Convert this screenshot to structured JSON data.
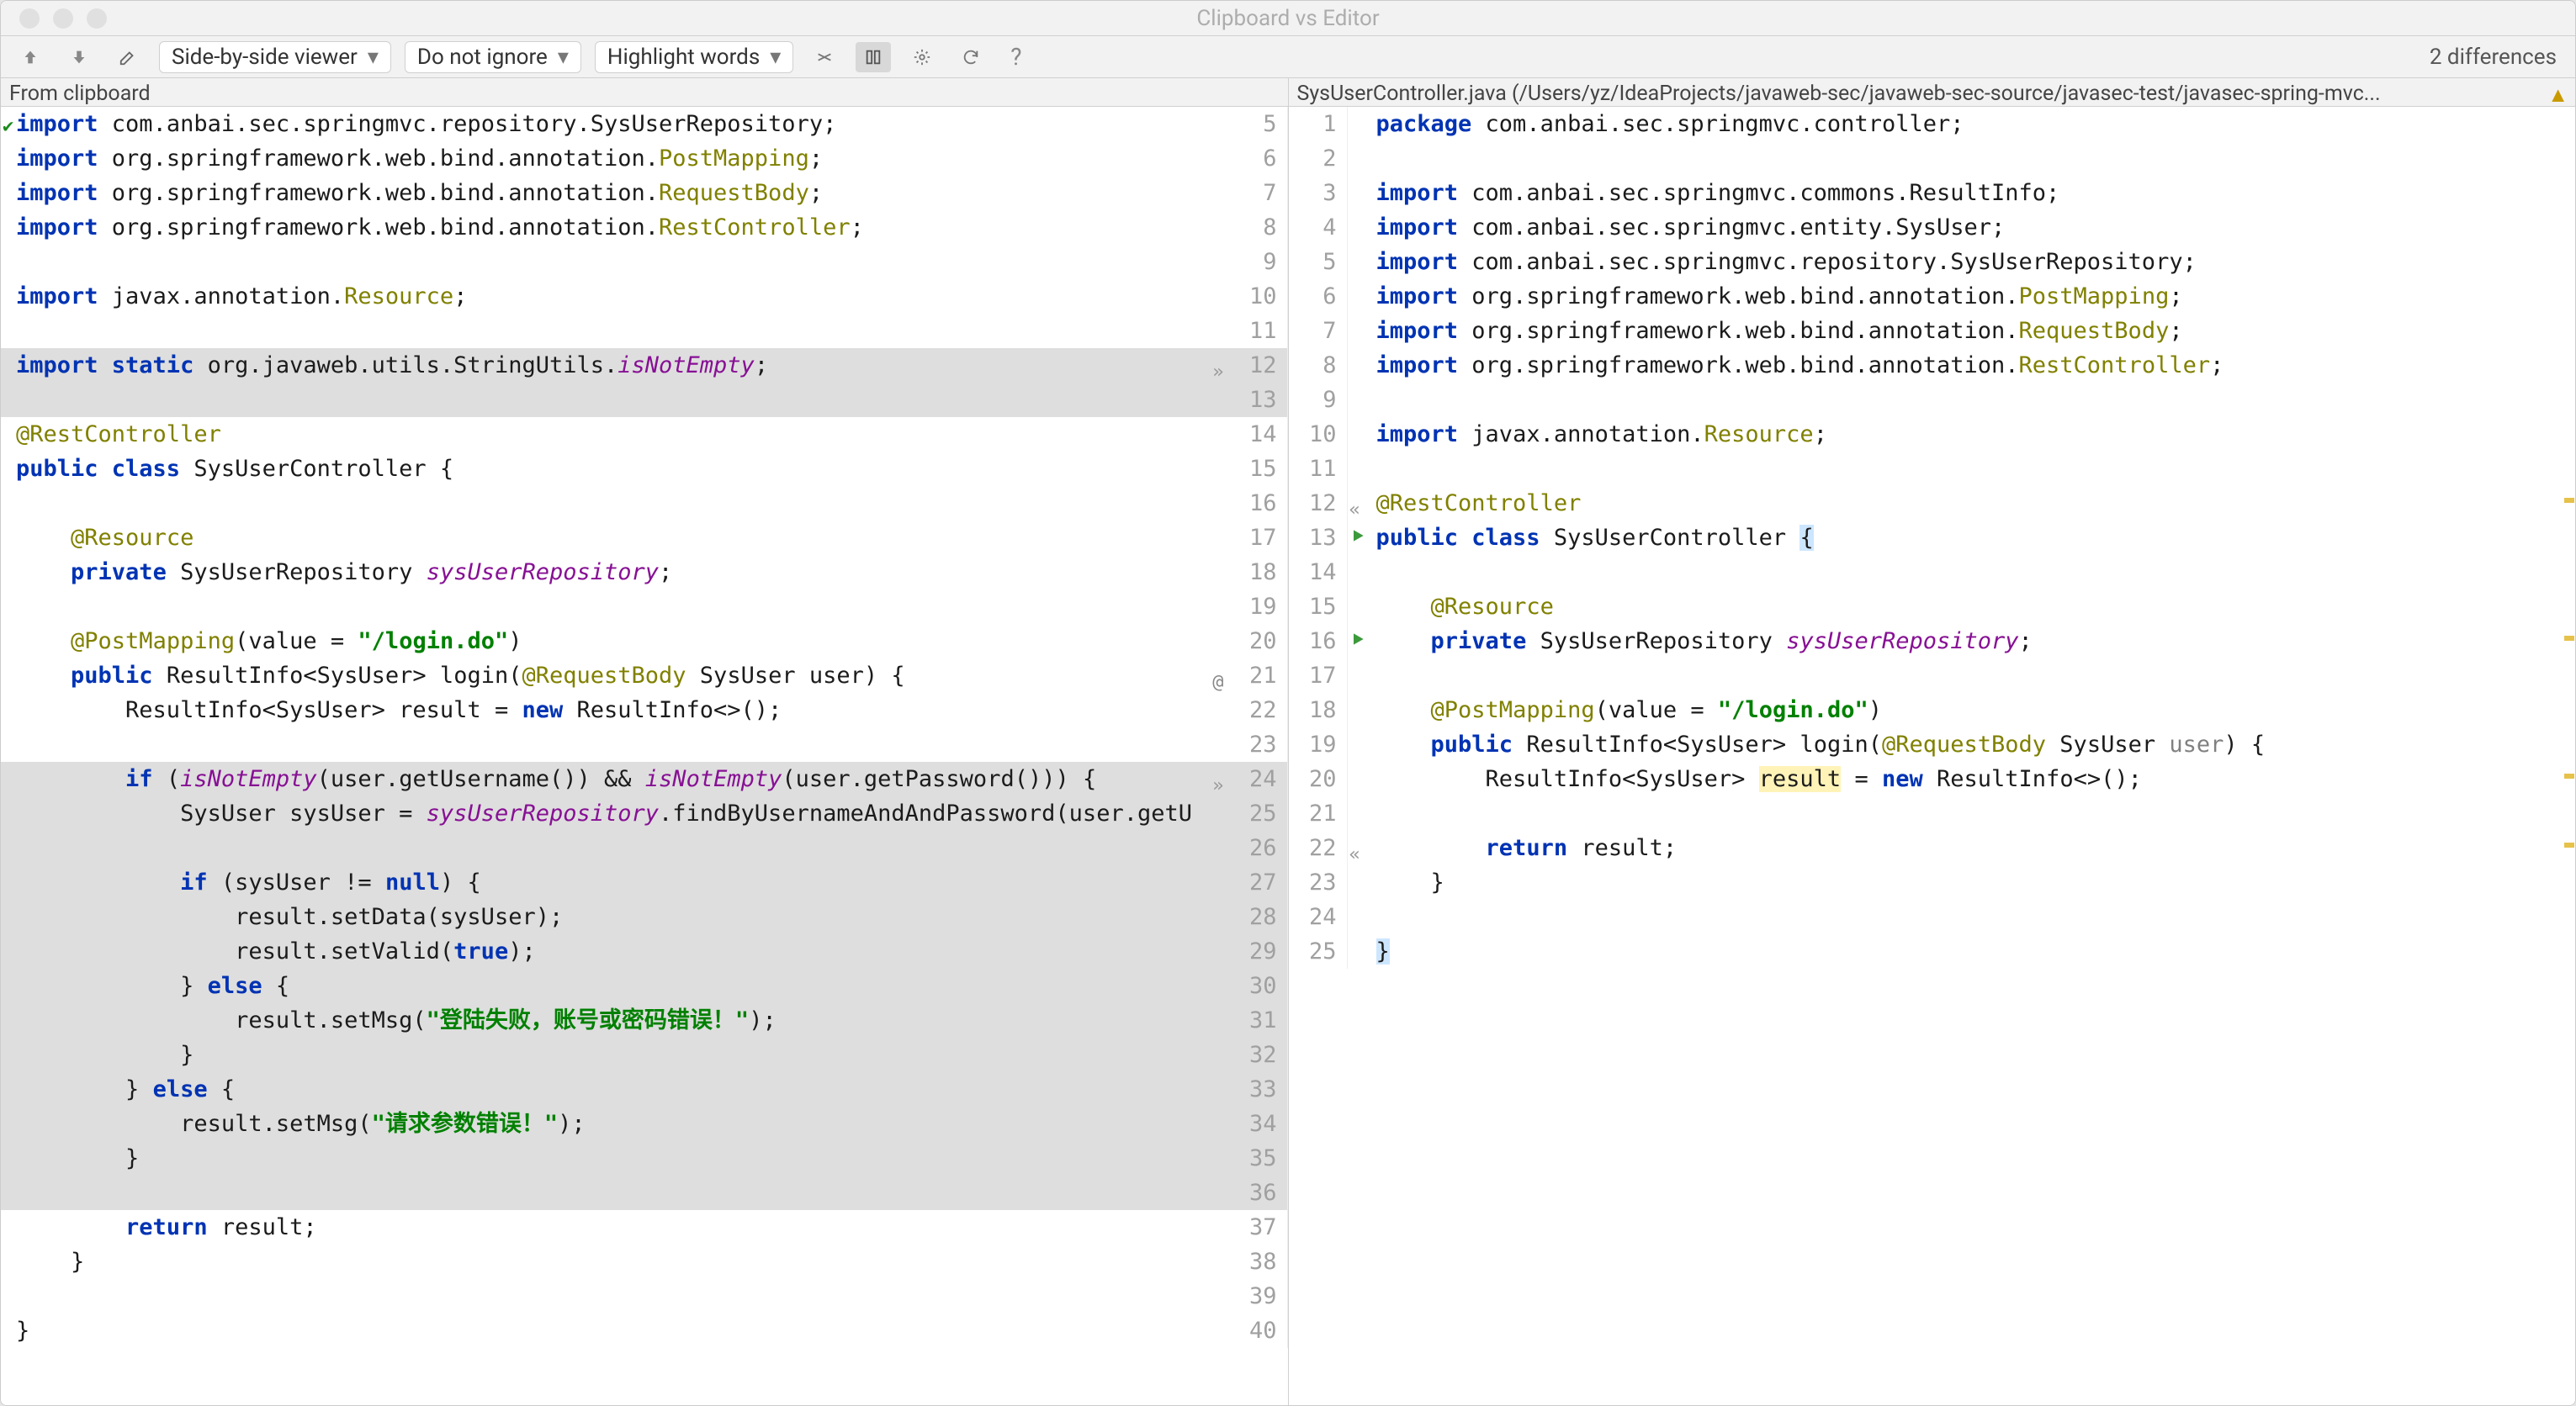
{
  "window": {
    "title": "Clipboard vs Editor"
  },
  "toolbar": {
    "viewer_mode": "Side-by-side viewer",
    "ignore_mode": "Do not ignore",
    "highlight_mode": "Highlight words",
    "diff_count": "2 differences"
  },
  "labels": {
    "left": "From clipboard",
    "right": "SysUserController.java (/Users/yz/IdeaProjects/javaweb-sec/javaweb-sec-source/javasec-test/javasec-spring-mvc..."
  },
  "left_lines": [
    {
      "n": "",
      "tokens": [
        [
          "kw",
          "import "
        ],
        [
          "",
          "com.anbai.sec.springmvc.repository.SysUserRepository;"
        ]
      ],
      "first": true
    },
    {
      "n": "",
      "tokens": [
        [
          "kw",
          "import "
        ],
        [
          "",
          "org.springframework.web.bind.annotation."
        ],
        [
          "ann",
          "PostMapping"
        ],
        [
          "",
          ";"
        ]
      ]
    },
    {
      "n": "",
      "tokens": [
        [
          "kw",
          "import "
        ],
        [
          "",
          "org.springframework.web.bind.annotation."
        ],
        [
          "ann",
          "RequestBody"
        ],
        [
          "",
          ";"
        ]
      ]
    },
    {
      "n": "",
      "tokens": [
        [
          "kw",
          "import "
        ],
        [
          "",
          "org.springframework.web.bind.annotation."
        ],
        [
          "ann",
          "RestController"
        ],
        [
          "",
          ";"
        ]
      ]
    },
    {
      "n": "",
      "tokens": [
        [
          "",
          ""
        ]
      ]
    },
    {
      "n": "",
      "tokens": [
        [
          "kw",
          "import "
        ],
        [
          "",
          "javax.annotation."
        ],
        [
          "ann",
          "Resource"
        ],
        [
          "",
          ";"
        ]
      ]
    },
    {
      "n": "",
      "tokens": [
        [
          "",
          ""
        ]
      ]
    },
    {
      "n": "",
      "tokens": [
        [
          "kw",
          "import static "
        ],
        [
          "",
          "org.javaweb.utils.StringUtils."
        ],
        [
          "idn",
          "isNotEmpty"
        ],
        [
          "",
          ";"
        ]
      ],
      "diff": true,
      "mergeRight": true
    },
    {
      "n": "",
      "tokens": [
        [
          "",
          ""
        ]
      ],
      "diff": true
    },
    {
      "n": "",
      "tokens": [
        [
          "ann",
          "@RestController"
        ]
      ]
    },
    {
      "n": "",
      "tokens": [
        [
          "kw",
          "public class "
        ],
        [
          "",
          "SysUserController {"
        ]
      ]
    },
    {
      "n": "",
      "tokens": [
        [
          "",
          ""
        ]
      ]
    },
    {
      "n": "",
      "tokens": [
        [
          "",
          "    "
        ],
        [
          "ann",
          "@Resource"
        ]
      ]
    },
    {
      "n": "",
      "tokens": [
        [
          "",
          "    "
        ],
        [
          "kw",
          "private "
        ],
        [
          "",
          "SysUserRepository "
        ],
        [
          "idn",
          "sysUserRepository"
        ],
        [
          "",
          ";"
        ]
      ]
    },
    {
      "n": "",
      "tokens": [
        [
          "",
          ""
        ]
      ]
    },
    {
      "n": "",
      "tokens": [
        [
          "",
          "    "
        ],
        [
          "ann",
          "@PostMapping"
        ],
        [
          "",
          "(value = "
        ],
        [
          "str",
          "\"/login.do\""
        ],
        [
          "",
          ")"
        ]
      ]
    },
    {
      "n": "",
      "tokens": [
        [
          "",
          "    "
        ],
        [
          "kw",
          "public "
        ],
        [
          "",
          "ResultInfo<SysUser> login("
        ],
        [
          "ann",
          "@RequestBody"
        ],
        [
          "",
          " SysUser user) {"
        ]
      ],
      "at": true
    },
    {
      "n": "",
      "tokens": [
        [
          "",
          "        ResultInfo<SysUser> result = "
        ],
        [
          "kw",
          "new "
        ],
        [
          "",
          "ResultInfo<>();"
        ]
      ]
    },
    {
      "n": "",
      "tokens": [
        [
          "",
          ""
        ]
      ]
    },
    {
      "n": "",
      "tokens": [
        [
          "",
          "        "
        ],
        [
          "kw",
          "if "
        ],
        [
          "",
          "("
        ],
        [
          "idn",
          "isNotEmpty"
        ],
        [
          "",
          "(user.getUsername()) && "
        ],
        [
          "idn",
          "isNotEmpty"
        ],
        [
          "",
          "(user.getPassword())) {"
        ]
      ],
      "diff": true,
      "mergeRight": true
    },
    {
      "n": "",
      "tokens": [
        [
          "",
          "            SysUser sysUser = "
        ],
        [
          "idn",
          "sysUserRepository"
        ],
        [
          "",
          ".findByUsernameAndAndPassword(user.getU"
        ]
      ],
      "diff": true
    },
    {
      "n": "",
      "tokens": [
        [
          "",
          ""
        ]
      ],
      "diff": true
    },
    {
      "n": "",
      "tokens": [
        [
          "",
          "            "
        ],
        [
          "kw",
          "if "
        ],
        [
          "",
          "(sysUser != "
        ],
        [
          "kw",
          "null"
        ],
        [
          "",
          ") {"
        ]
      ],
      "diff": true
    },
    {
      "n": "",
      "tokens": [
        [
          "",
          "                result.setData(sysUser);"
        ]
      ],
      "diff": true
    },
    {
      "n": "",
      "tokens": [
        [
          "",
          "                result.setValid("
        ],
        [
          "kw",
          "true"
        ],
        [
          "",
          ");"
        ]
      ],
      "diff": true
    },
    {
      "n": "",
      "tokens": [
        [
          "",
          "            } "
        ],
        [
          "kw",
          "else "
        ],
        [
          "",
          "{"
        ]
      ],
      "diff": true
    },
    {
      "n": "",
      "tokens": [
        [
          "",
          "                result.setMsg("
        ],
        [
          "strq",
          "\"登陆失败，账号或密码错误！\""
        ],
        [
          "",
          ");"
        ]
      ],
      "diff": true
    },
    {
      "n": "",
      "tokens": [
        [
          "",
          "            }"
        ]
      ],
      "diff": true
    },
    {
      "n": "",
      "tokens": [
        [
          "",
          "        } "
        ],
        [
          "kw",
          "else "
        ],
        [
          "",
          "{"
        ]
      ],
      "diff": true
    },
    {
      "n": "",
      "tokens": [
        [
          "",
          "            result.setMsg("
        ],
        [
          "strq",
          "\"请求参数错误！\""
        ],
        [
          "",
          ");"
        ]
      ],
      "diff": true
    },
    {
      "n": "",
      "tokens": [
        [
          "",
          "        }"
        ]
      ],
      "diff": true
    },
    {
      "n": "",
      "tokens": [
        [
          "",
          ""
        ]
      ],
      "diff": true
    },
    {
      "n": "",
      "tokens": [
        [
          "",
          "        "
        ],
        [
          "kw",
          "return "
        ],
        [
          "",
          "result;"
        ]
      ]
    },
    {
      "n": "",
      "tokens": [
        [
          "",
          "    }"
        ]
      ]
    },
    {
      "n": "",
      "tokens": [
        [
          "",
          ""
        ]
      ]
    },
    {
      "n": "",
      "tokens": [
        [
          "",
          "}"
        ]
      ]
    }
  ],
  "left_gutter_start": 5,
  "right_gutter_start": 1,
  "right_lines": [
    {
      "rn": 1,
      "tokens": [
        [
          "kw",
          "package "
        ],
        [
          "",
          "com.anbai.sec.springmvc.controller;"
        ]
      ]
    },
    {
      "rn": 2,
      "tokens": [
        [
          "",
          ""
        ]
      ]
    },
    {
      "rn": 3,
      "tokens": [
        [
          "kw",
          "import "
        ],
        [
          "",
          "com.anbai.sec.springmvc.commons.ResultInfo;"
        ]
      ]
    },
    {
      "rn": 4,
      "tokens": [
        [
          "kw",
          "import "
        ],
        [
          "",
          "com.anbai.sec.springmvc.entity.SysUser;"
        ]
      ]
    },
    {
      "rn": 5,
      "tokens": [
        [
          "kw",
          "import "
        ],
        [
          "",
          "com.anbai.sec.springmvc.repository.SysUserRepository;"
        ]
      ]
    },
    {
      "rn": 6,
      "tokens": [
        [
          "kw",
          "import "
        ],
        [
          "",
          "org.springframework.web.bind.annotation."
        ],
        [
          "ann",
          "PostMapping"
        ],
        [
          "",
          ";"
        ]
      ]
    },
    {
      "rn": 7,
      "tokens": [
        [
          "kw",
          "import "
        ],
        [
          "",
          "org.springframework.web.bind.annotation."
        ],
        [
          "ann",
          "RequestBody"
        ],
        [
          "",
          ";"
        ]
      ]
    },
    {
      "rn": 8,
      "tokens": [
        [
          "kw",
          "import "
        ],
        [
          "",
          "org.springframework.web.bind.annotation."
        ],
        [
          "ann",
          "RestController"
        ],
        [
          "",
          ";"
        ]
      ]
    },
    {
      "rn": 9,
      "tokens": [
        [
          "",
          ""
        ]
      ]
    },
    {
      "rn": 10,
      "tokens": [
        [
          "kw",
          "import "
        ],
        [
          "",
          "javax.annotation."
        ],
        [
          "ann",
          "Resource"
        ],
        [
          "",
          ";"
        ]
      ]
    },
    {
      "rn": 11,
      "tokens": [
        [
          "",
          ""
        ]
      ]
    },
    {
      "rn": 12,
      "tokens": [
        [
          "ann",
          "@RestController"
        ]
      ],
      "collapseLeft": true,
      "tickY": true
    },
    {
      "rn": 13,
      "tokens": [
        [
          "kw",
          "public class "
        ],
        [
          "",
          "SysUserController "
        ],
        [
          "bhl",
          "{"
        ]
      ],
      "run": true
    },
    {
      "rn": 14,
      "tokens": [
        [
          "",
          ""
        ]
      ]
    },
    {
      "rn": 15,
      "tokens": [
        [
          "",
          "    "
        ],
        [
          "ann",
          "@Resource"
        ]
      ]
    },
    {
      "rn": 16,
      "tokens": [
        [
          "",
          "    "
        ],
        [
          "kw",
          "private "
        ],
        [
          "",
          "SysUserRepository "
        ],
        [
          "idn",
          "sysUserRepository"
        ],
        [
          "",
          ";"
        ]
      ],
      "run": true,
      "tickY": true
    },
    {
      "rn": 17,
      "tokens": [
        [
          "",
          ""
        ]
      ]
    },
    {
      "rn": 18,
      "tokens": [
        [
          "",
          "    "
        ],
        [
          "ann",
          "@PostMapping"
        ],
        [
          "",
          "(value = "
        ],
        [
          "str",
          "\"/login.do\""
        ],
        [
          "",
          ")"
        ]
      ]
    },
    {
      "rn": 19,
      "tokens": [
        [
          "",
          "    "
        ],
        [
          "kw",
          "public "
        ],
        [
          "",
          "ResultInfo<SysUser> login("
        ],
        [
          "ann",
          "@RequestBody"
        ],
        [
          "",
          " SysUser "
        ],
        [
          "par",
          "user"
        ],
        [
          "",
          ") {"
        ]
      ]
    },
    {
      "rn": 20,
      "tokens": [
        [
          "",
          "        ResultInfo<SysUser> "
        ],
        [
          "hl",
          "result"
        ],
        [
          "",
          " = "
        ],
        [
          "kw",
          "new "
        ],
        [
          "",
          "ResultInfo<>();"
        ]
      ],
      "tickY": true
    },
    {
      "rn": 21,
      "tokens": [
        [
          "",
          ""
        ]
      ]
    },
    {
      "rn": 22,
      "tokens": [
        [
          "",
          "        "
        ],
        [
          "kw",
          "return "
        ],
        [
          "",
          "result;"
        ]
      ],
      "collapseLeft": true,
      "tickY": true
    },
    {
      "rn": 23,
      "tokens": [
        [
          "",
          "    }"
        ]
      ]
    },
    {
      "rn": 24,
      "tokens": [
        [
          "",
          ""
        ]
      ]
    },
    {
      "rn": 25,
      "tokens": [
        [
          "bhl",
          "}"
        ]
      ]
    }
  ]
}
